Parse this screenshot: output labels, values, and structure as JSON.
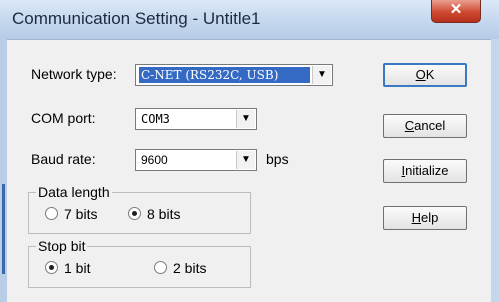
{
  "window": {
    "title": "Communication Setting - Untitle1",
    "close_glyph": "✕"
  },
  "fields": {
    "network_type": {
      "label": "Network type:",
      "value": "C-NET (RS232C, USB)"
    },
    "com_port": {
      "label": "COM port:",
      "value": "COM3"
    },
    "baud_rate": {
      "label": "Baud rate:",
      "value": "9600",
      "unit": "bps"
    }
  },
  "data_length": {
    "title": "Data length",
    "options": [
      {
        "label": "7 bits",
        "selected": false
      },
      {
        "label": "8 bits",
        "selected": true
      }
    ]
  },
  "stop_bit": {
    "title": "Stop bit",
    "options": [
      {
        "label": "1 bit",
        "selected": true
      },
      {
        "label": "2 bits",
        "selected": false
      }
    ]
  },
  "buttons": {
    "ok": {
      "label": "OK",
      "mnemonic": "O"
    },
    "cancel": {
      "label": "Cancel",
      "mnemonic": "C"
    },
    "initialize": {
      "label": "Initialize",
      "mnemonic": "I"
    },
    "help": {
      "label": "Help",
      "mnemonic": "H"
    }
  },
  "colors": {
    "selection": "#3469c4",
    "default_button_border": "#3b78c2",
    "close_button": "#cf4a32"
  },
  "icons": {
    "dropdown": "chevron-down-icon",
    "close": "close-icon"
  }
}
